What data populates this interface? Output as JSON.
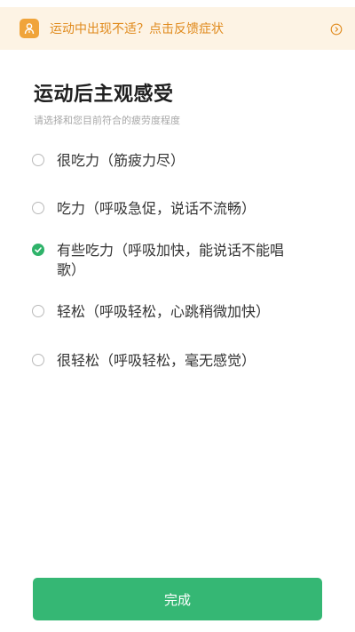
{
  "banner": {
    "text": "运动中出现不适？点击反馈症状",
    "icon": "doctor-icon",
    "arrow_icon": "chevron-right-circle-icon",
    "accent_color": "#f0a43a"
  },
  "header": {
    "title": "运动后主观感受",
    "subtitle": "请选择和您目前符合的疲劳度程度"
  },
  "options": [
    {
      "label": "很吃力（筋疲力尽）",
      "selected": false
    },
    {
      "label": "吃力（呼吸急促，说话不流畅）",
      "selected": false
    },
    {
      "label": "有些吃力（呼吸加快，能说话不能唱歌）",
      "selected": true
    },
    {
      "label": "轻松（呼吸轻松，心跳稍微加快）",
      "selected": false
    },
    {
      "label": "很轻松（呼吸轻松，毫无感觉）",
      "selected": false
    }
  ],
  "footer": {
    "done_label": "完成",
    "button_color": "#35b774"
  }
}
